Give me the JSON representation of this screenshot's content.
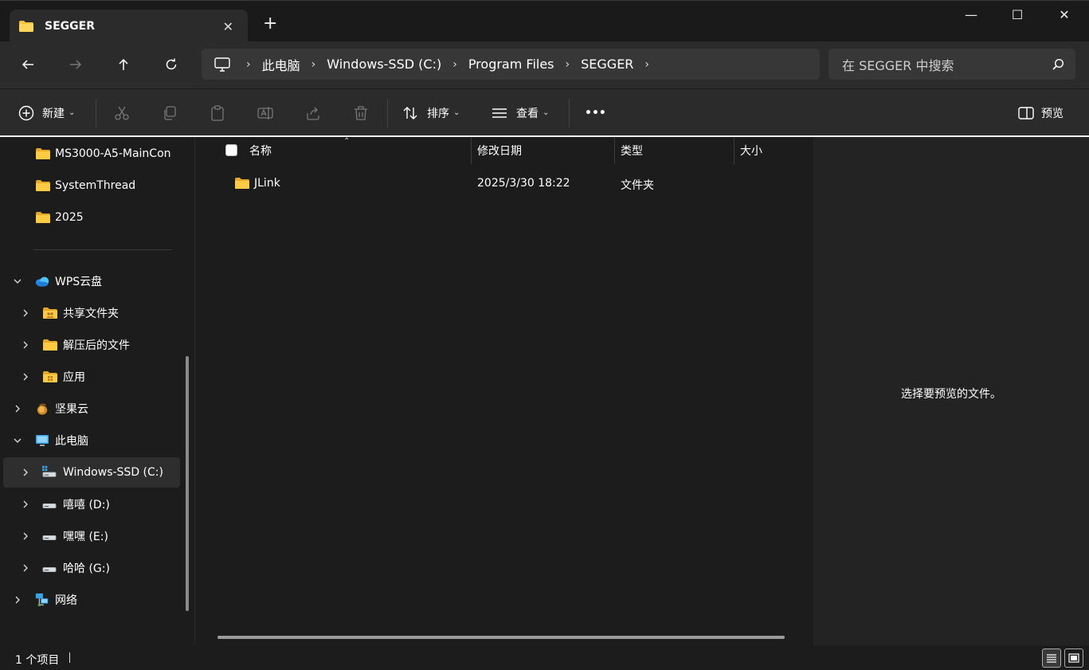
{
  "tab": {
    "title": "SEGGER",
    "close": "✕",
    "new_tab": "+"
  },
  "window_controls": {
    "minimize": "—",
    "maximize": "☐",
    "close": "✕"
  },
  "address": {
    "crumbs": [
      "此电脑",
      "Windows-SSD (C:)",
      "Program Files",
      "SEGGER"
    ],
    "sep": "›"
  },
  "search": {
    "placeholder": "在 SEGGER 中搜索"
  },
  "toolbar": {
    "new_label": "新建",
    "sort_label": "排序",
    "view_label": "查看",
    "more_label": "•••",
    "preview_label": "预览",
    "caret": "⌄"
  },
  "sidebar": {
    "items": [
      {
        "label": "MS3000-A5-MainCon",
        "icon": "folder-icon"
      },
      {
        "label": "SystemThread",
        "icon": "folder-icon"
      },
      {
        "label": "2025",
        "icon": "folder-icon"
      },
      {
        "label": "WPS云盘",
        "icon": "cloud-icon"
      },
      {
        "label": "共享文件夹",
        "icon": "shared-folder-icon"
      },
      {
        "label": "解压后的文件",
        "icon": "folder-icon"
      },
      {
        "label": "应用",
        "icon": "app-folder-icon"
      },
      {
        "label": "坚果云",
        "icon": "nut-icon"
      },
      {
        "label": "此电脑",
        "icon": "pc-icon"
      },
      {
        "label": "Windows-SSD (C:)",
        "icon": "drive-icon"
      },
      {
        "label": "嘻嘻 (D:)",
        "icon": "drive-icon"
      },
      {
        "label": "嘿嘿 (E:)",
        "icon": "drive-icon"
      },
      {
        "label": "哈哈 (G:)",
        "icon": "drive-icon"
      },
      {
        "label": "网络",
        "icon": "network-icon"
      }
    ]
  },
  "list": {
    "columns": [
      "名称",
      "修改日期",
      "类型",
      "大小"
    ],
    "rows": [
      {
        "name": "JLink",
        "modified": "2025/3/30 18:22",
        "type": "文件夹",
        "size": ""
      }
    ]
  },
  "preview": {
    "message": "选择要预览的文件。"
  },
  "status": {
    "count": "1 个项目"
  },
  "colors": {
    "folder": "#f4c542",
    "background": "#1c1c1c",
    "chrome": "#2b2b2b"
  }
}
